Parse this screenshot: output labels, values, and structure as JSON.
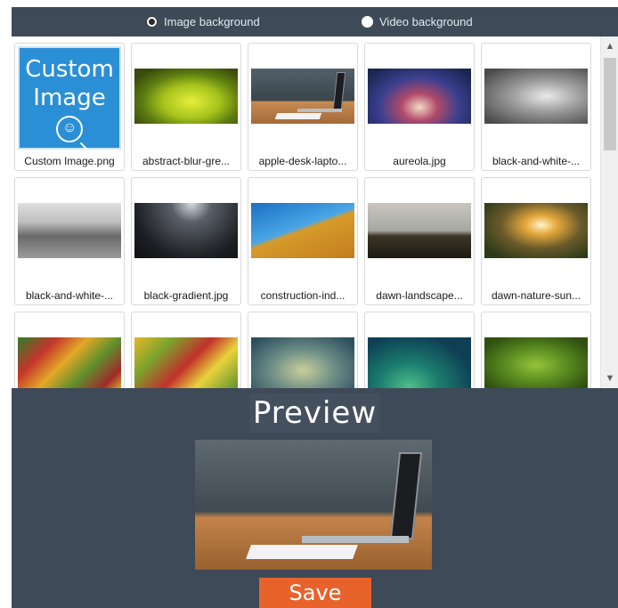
{
  "background_type": {
    "options": [
      {
        "label": "Image background",
        "selected": true
      },
      {
        "label": "Video background",
        "selected": false
      }
    ]
  },
  "gallery": {
    "items": [
      {
        "label": "Custom Image.png",
        "thumb": "custom",
        "custom_text_1": "Custom",
        "custom_text_2": "Image",
        "icon": "user-search-icon"
      },
      {
        "label": "abstract-blur-gre...",
        "thumb": "t-abstract"
      },
      {
        "label": "apple-desk-lapto...",
        "thumb": "t-desk"
      },
      {
        "label": "aureola.jpg",
        "thumb": "t-aureola"
      },
      {
        "label": "black-and-white-...",
        "thumb": "t-bw1"
      },
      {
        "label": "black-and-white-...",
        "thumb": "t-city"
      },
      {
        "label": "black-gradient.jpg",
        "thumb": "t-blackgrad"
      },
      {
        "label": "construction-ind...",
        "thumb": "t-constr"
      },
      {
        "label": "dawn-landscape...",
        "thumb": "t-dawn"
      },
      {
        "label": "dawn-nature-sun...",
        "thumb": "t-nature"
      },
      {
        "label": "",
        "thumb": "t-fruit1"
      },
      {
        "label": "",
        "thumb": "t-fruit2"
      },
      {
        "label": "",
        "thumb": "t-teal"
      },
      {
        "label": "",
        "thumb": "t-green"
      },
      {
        "label": "",
        "thumb": "t-leaves"
      }
    ]
  },
  "scrollbar": {
    "up_icon": "▲",
    "down_icon": "▼"
  },
  "preview": {
    "title": "Preview",
    "save_label": "Save"
  },
  "colors": {
    "header_bg": "#3e4a57",
    "save_button": "#e8622c",
    "custom_tile": "#2b8fd6"
  }
}
